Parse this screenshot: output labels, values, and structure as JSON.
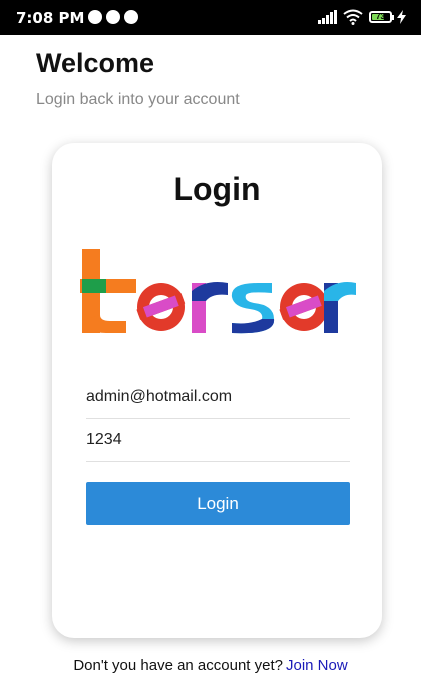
{
  "status_bar": {
    "time": "7:08 PM",
    "battery": "73",
    "battery_level": 0.73,
    "icons": [
      "app-notification-icon",
      "app-notification-icon",
      "app-notification-icon",
      "cell-signal-icon",
      "wifi-icon",
      "battery-icon",
      "charging-icon"
    ]
  },
  "header": {
    "title": "Welcome",
    "subtitle": "Login back into your account"
  },
  "card": {
    "title": "Login",
    "logo_text": "terser",
    "email_value": "admin@hotmail.com",
    "password_value": "1234",
    "login_button": "Login"
  },
  "footer": {
    "prompt": "Don't you have an account yet?",
    "link": "Join Now"
  },
  "colors": {
    "primary_button": "#2c8ad8",
    "link": "#1a1ab8",
    "subtitle": "#888888",
    "status_bar": "#000000",
    "logo_orange": "#f57c1f",
    "logo_red": "#e23a2a",
    "logo_pink": "#d94cc7",
    "logo_blue": "#1e3a9e",
    "logo_cyan": "#29b5e8",
    "logo_green": "#1e9e4a"
  }
}
